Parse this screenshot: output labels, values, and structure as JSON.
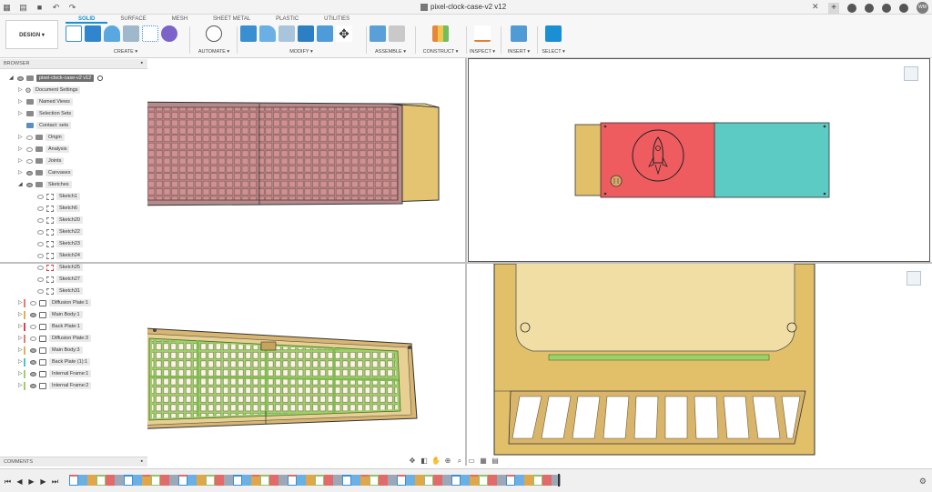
{
  "app": {
    "document_title": "pixel-clock-case-v2 v12",
    "avatar_initials": "WM"
  },
  "ribbon": {
    "workspace_label": "DESIGN ▾",
    "tabs": [
      {
        "label": "SOLID",
        "active": true
      },
      {
        "label": "SURFACE",
        "active": false
      },
      {
        "label": "MESH",
        "active": false
      },
      {
        "label": "SHEET METAL",
        "active": false
      },
      {
        "label": "PLASTIC",
        "active": false
      },
      {
        "label": "UTILITIES",
        "active": false
      }
    ],
    "groups": {
      "create": "CREATE ▾",
      "automate": "AUTOMATE ▾",
      "modify": "MODIFY ▾",
      "assemble": "ASSEMBLE ▾",
      "construct": "CONSTRUCT ▾",
      "inspect": "INSPECT ▾",
      "insert": "INSERT ▾",
      "select": "SELECT ▾"
    }
  },
  "browser": {
    "title": "BROWSER",
    "root": "pixel-clock-case-v2 v12",
    "items": [
      {
        "label": "Document Settings"
      },
      {
        "label": "Named Views"
      },
      {
        "label": "Selection Sets"
      },
      {
        "label": "Contact: sets"
      },
      {
        "label": "Origin"
      },
      {
        "label": "Analysis"
      },
      {
        "label": "Joints"
      },
      {
        "label": "Canvases"
      },
      {
        "label": "Sketches"
      }
    ],
    "sketches": [
      "Sketch1",
      "Sketch6",
      "Sketch20",
      "Sketch22",
      "Sketch23",
      "Sketch24",
      "Sketch25",
      "Sketch27",
      "Sketch31"
    ],
    "bodies": [
      {
        "label": "Diffusion Plate:1",
        "color": "#e9787a"
      },
      {
        "label": "Main Body:1",
        "color": "#d9b35a"
      },
      {
        "label": "Back Plate:1",
        "color": "#e0404a"
      },
      {
        "label": "Diffusion Plate:3",
        "color": "#e9787a"
      },
      {
        "label": "Main Body:3",
        "color": "#d9b35a"
      },
      {
        "label": "Back Plate (1):1",
        "color": "#4cc4c0"
      },
      {
        "label": "Internal Frame:1",
        "color": "#9bd16a"
      },
      {
        "label": "Internal Frame:2",
        "color": "#9bd16a"
      }
    ]
  },
  "comments": {
    "title": "COMMENTS"
  },
  "colors": {
    "accent": "#1a8fd4",
    "case_gold": "#e2c06a",
    "diffuser_pink": "#c98c8c",
    "back_red": "#ee5c60",
    "back_teal": "#5ccbc4",
    "frame_green": "#9bd16a"
  }
}
